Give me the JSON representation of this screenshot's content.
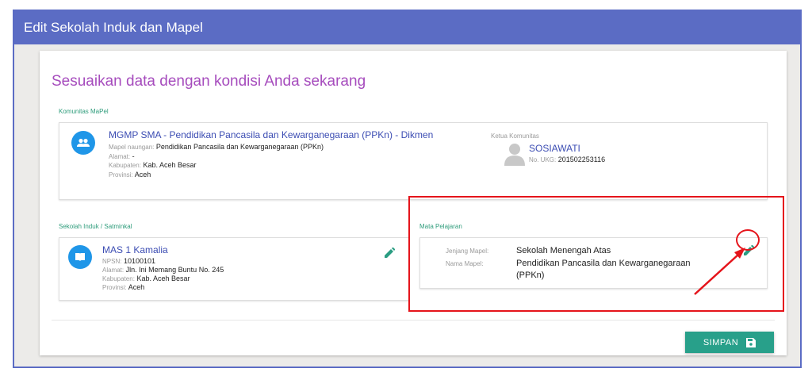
{
  "window": {
    "title": "Edit Sekolah Induk dan Mapel"
  },
  "headline": "Sesuaikan data dengan kondisi Anda sekarang",
  "komunitas": {
    "section_label": "Komunitas MaPel",
    "name": "MGMP SMA - Pendidikan Pancasila dan Kewarganegaraan (PPKn) - Dikmen",
    "mapel_key": "Mapel naungan:",
    "mapel_val": "Pendidikan Pancasila dan Kewarganegaraan (PPKn)",
    "alamat_key": "Alamat:",
    "alamat_val": "-",
    "kabupaten_key": "Kabupaten:",
    "kabupaten_val": "Kab. Aceh Besar",
    "provinsi_key": "Provinsi:",
    "provinsi_val": "Aceh",
    "ketua_label": "Ketua Komunitas",
    "ketua_name": "SOSIAWATI",
    "ketua_ukg_key": "No. UKG:",
    "ketua_ukg_val": "201502253116"
  },
  "sekolah": {
    "section_label": "Sekolah Induk / Satminkal",
    "name": "MAS 1 Kamalia",
    "npsn_key": "NPSN:",
    "npsn_val": "10100101",
    "alamat_key": "Alamat:",
    "alamat_val": "Jln. Ini Memang Buntu No. 245",
    "kabupaten_key": "Kabupaten:",
    "kabupaten_val": "Kab. Aceh Besar",
    "provinsi_key": "Provinsi:",
    "provinsi_val": "Aceh"
  },
  "mapel": {
    "section_label": "Mata Pelajaran",
    "jenjang_key": "Jenjang Mapel:",
    "jenjang_val": "Sekolah Menengah Atas",
    "nama_key": "Nama Mapel:",
    "nama_val_line1": "Pendidikan Pancasila dan Kewarganegaraan",
    "nama_val_line2": "(PPKn)"
  },
  "buttons": {
    "save_label": "SIMPAN"
  },
  "colors": {
    "header": "#5b6cc4",
    "accent_teal": "#28a08a",
    "icon_blue": "#1f96e8",
    "highlight_red": "#e5141b"
  }
}
